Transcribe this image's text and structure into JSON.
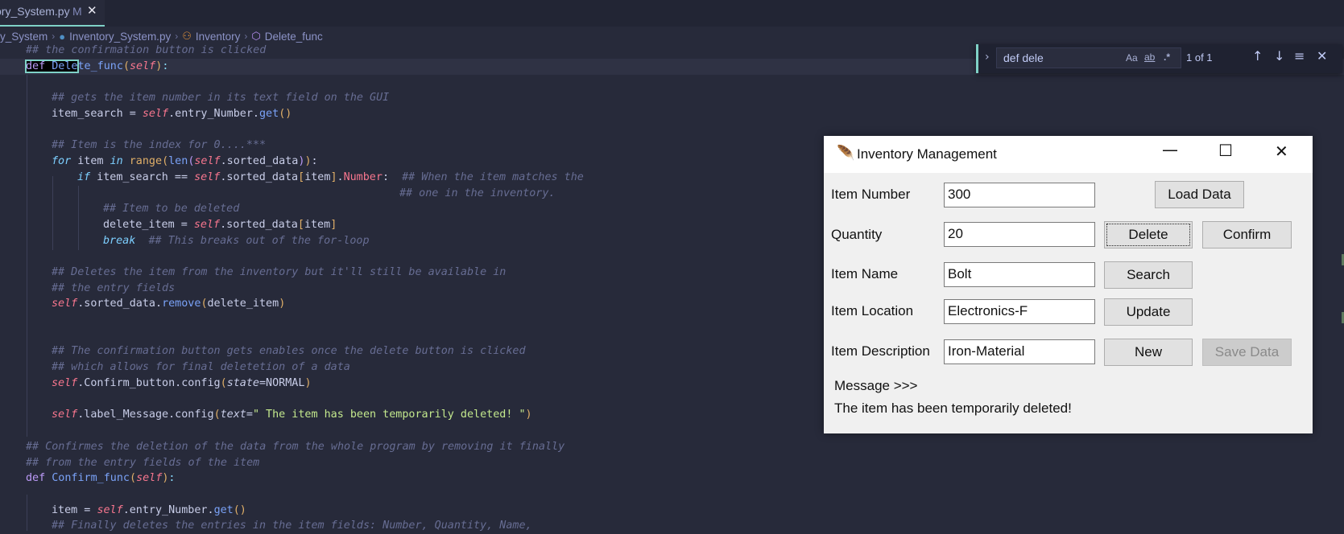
{
  "editor": {
    "tab": {
      "filename": "ory_System.py",
      "modified_badge": "M",
      "close_glyph": "✕"
    },
    "breadcrumb": {
      "items": [
        {
          "label": "y_System",
          "icon": "folder"
        },
        {
          "label": "Inventory_System.py",
          "icon": "python-icon"
        },
        {
          "label": "Inventory",
          "icon": "class-icon"
        },
        {
          "label": "Delete_func",
          "icon": "method-cube-icon"
        }
      ],
      "separator": "›"
    },
    "code_lines": [
      "## the confirmation button is clicked",
      "def Delete_func(self):",
      "",
      "## gets the item number in its text field on the GUI",
      "item_search = self.entry_Number.get()",
      "",
      "## Item is the index for 0....***",
      "for item in range(len(self.sorted_data)):",
      "if item_search == self.sorted_data[item].Number:  ## When the item matches the",
      "## one in the inventory.",
      "## Item to be deleted",
      "delete_item = self.sorted_data[item]",
      "break  ## This breaks out of the for-loop",
      "",
      "## Deletes the item from the inventory but it'll still be available in",
      "## the entry fields",
      "self.sorted_data.remove(delete_item)",
      "",
      "",
      "## The confirmation button gets enables once the delete button is clicked",
      "## which allows for final deletetion of a data",
      "self.Confirm_button.config(state=NORMAL)",
      "",
      "self.label_Message.config(text=\" The item has been temporarily deleted! \")",
      "",
      "## Confirmes the deletion of the data from the whole program by removing it finally",
      "## from the entry fields of the item",
      "def Confirm_func(self):",
      "",
      "item = self.entry_Number.get()",
      "## Finally deletes the entries in the item fields: Number, Quantity, Name,"
    ]
  },
  "find_widget": {
    "query": "def dele",
    "match_case_label": "Aa",
    "whole_word_label": "ab",
    "regex_label": ".*",
    "result_count": "1 of 1",
    "prev_glyph": "↑",
    "next_glyph": "↓",
    "selection_glyph": "≡",
    "close_glyph": "✕",
    "toggle_glyph": "›"
  },
  "app_window": {
    "title": "Inventory Management",
    "controls": {
      "minimize": "—",
      "maximize": "☐",
      "close": "✕"
    },
    "fields": [
      {
        "label": "Item Number",
        "value": "300"
      },
      {
        "label": "Quantity",
        "value": "20"
      },
      {
        "label": "Item Name",
        "value": "Bolt"
      },
      {
        "label": "Item Location",
        "value": "Electronics-F"
      },
      {
        "label": "Item Description",
        "value": "Iron-Material"
      }
    ],
    "buttons": {
      "load_data": "Load Data",
      "delete": "Delete",
      "confirm": "Confirm",
      "search": "Search",
      "update": "Update",
      "new": "New",
      "save_data": "Save Data"
    },
    "message_header": "Message >>>",
    "message_text": "The item has been temporarily deleted!"
  },
  "colors": {
    "editor_bg": "#272a3a",
    "accent": "#7fd1c7",
    "comment": "#676d93",
    "keyword": "#bb9af7",
    "self": "#f7768e",
    "string": "#c3e88d"
  }
}
